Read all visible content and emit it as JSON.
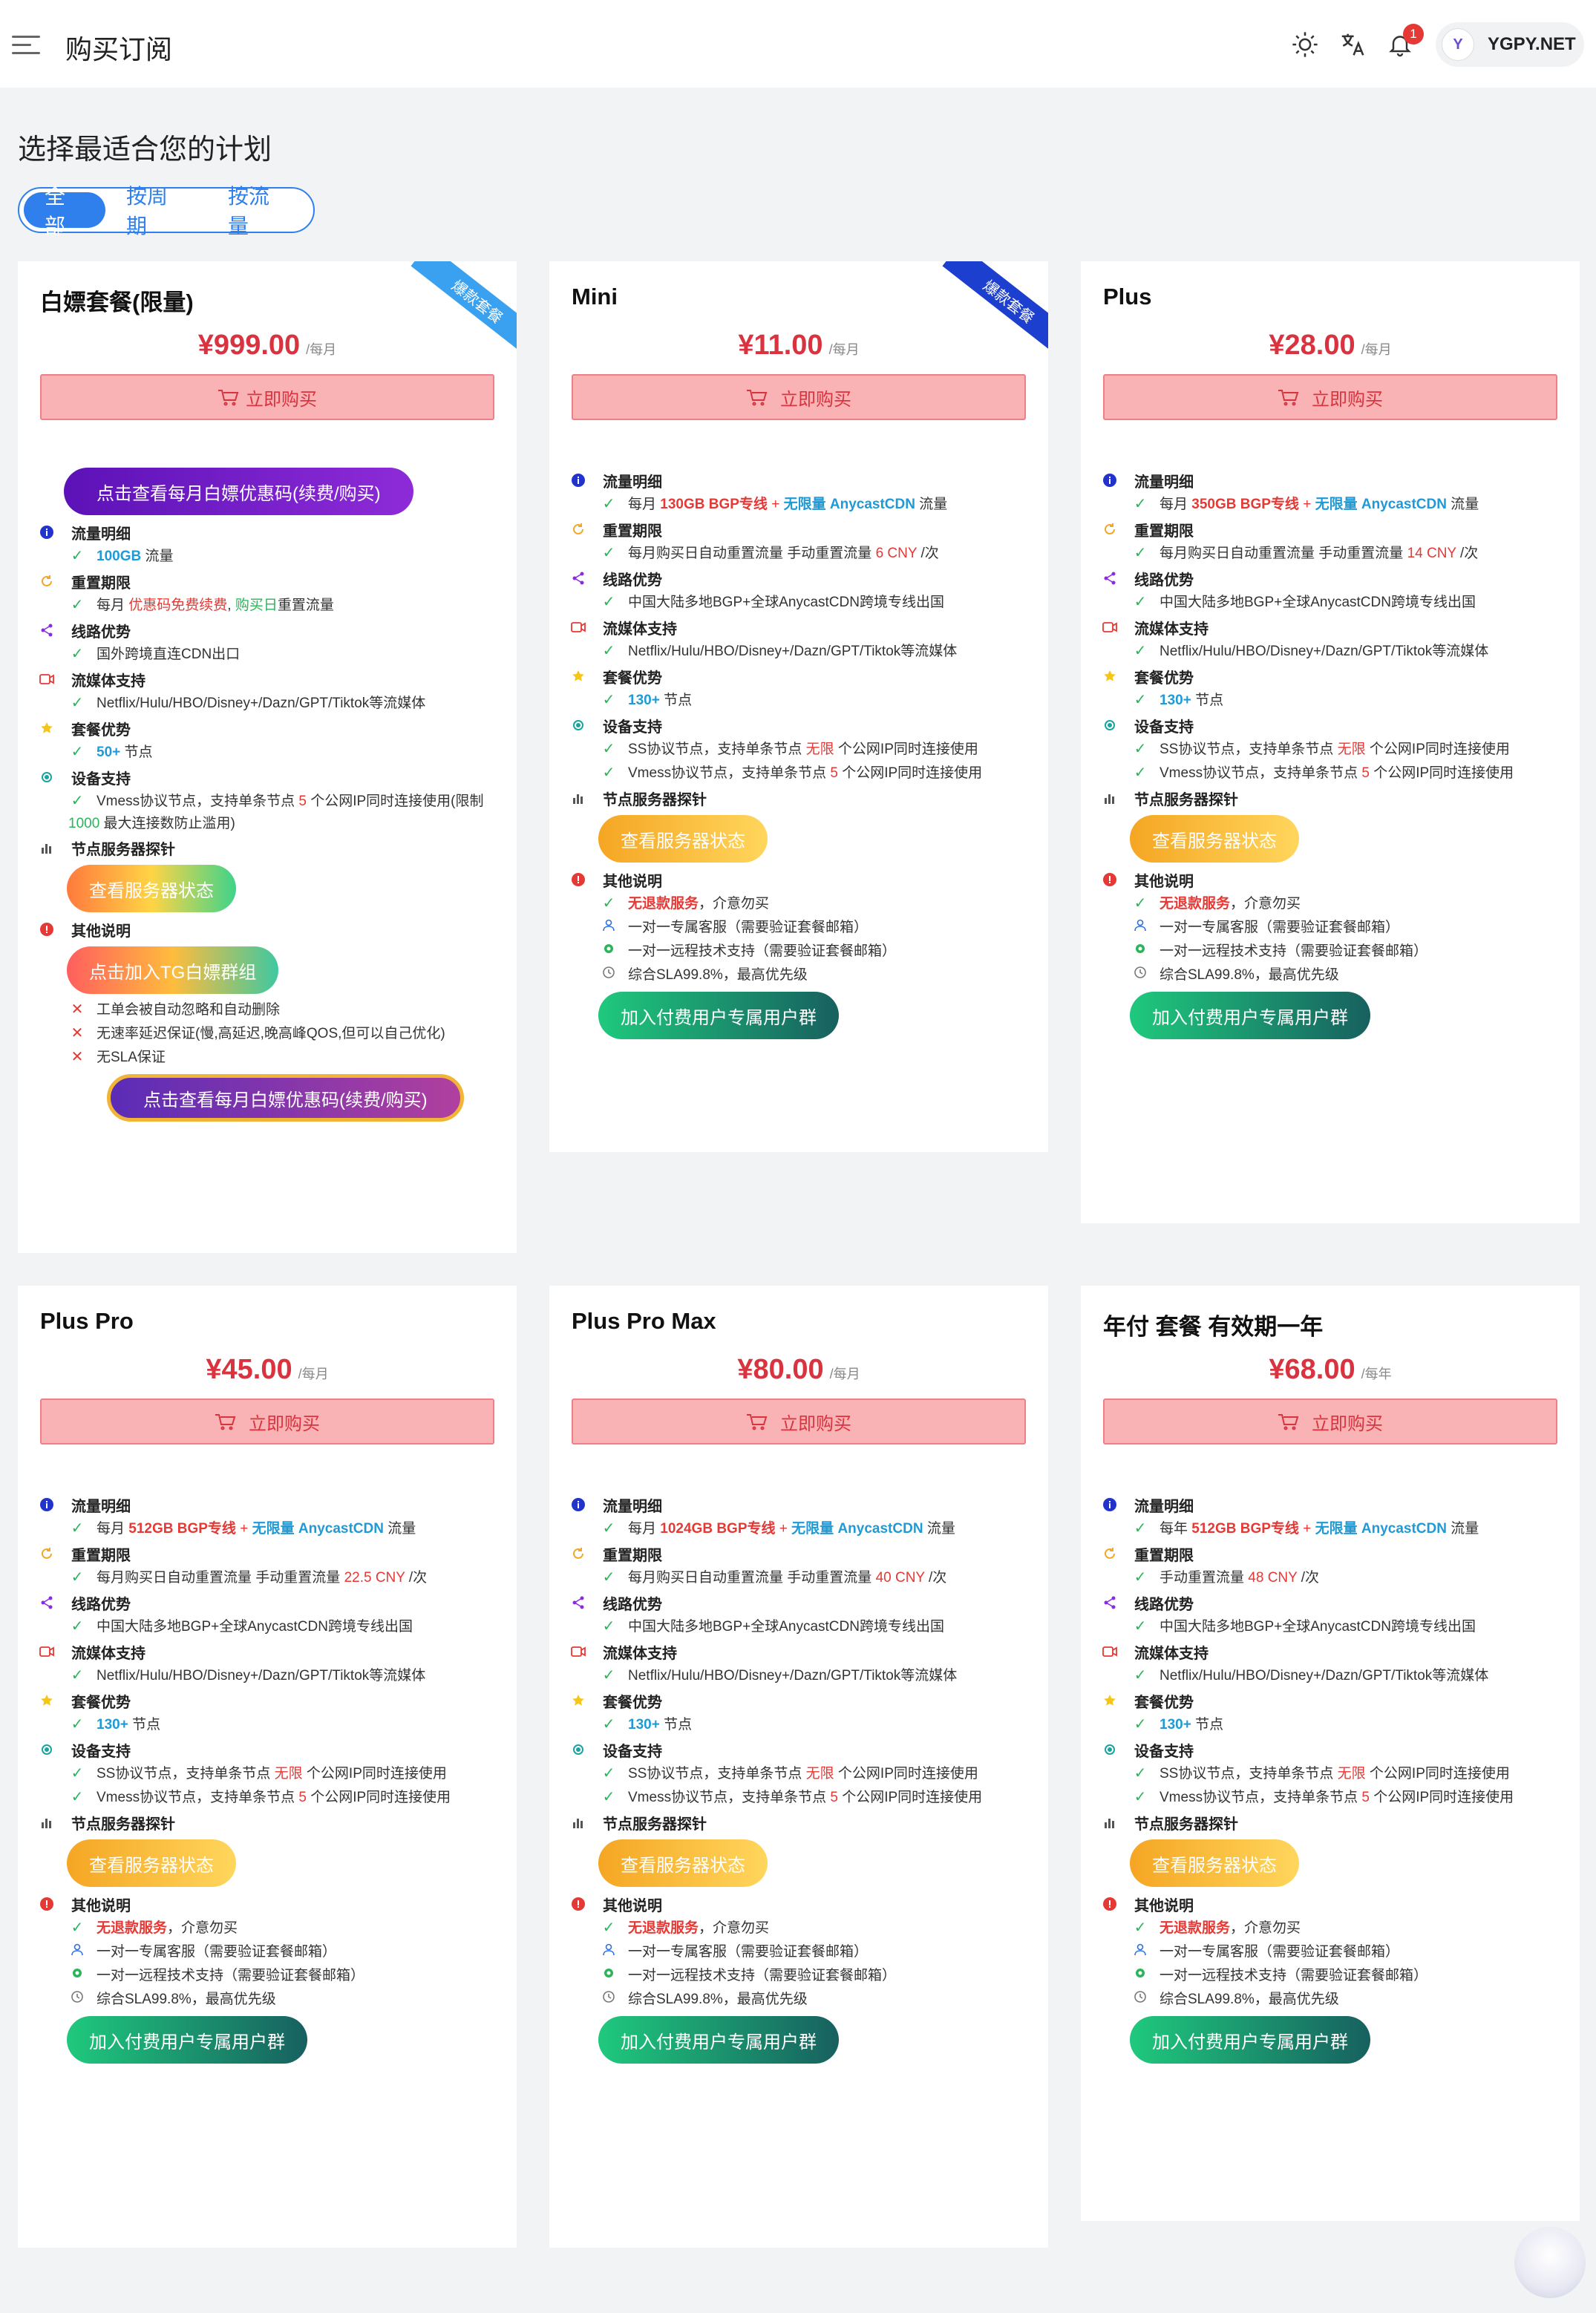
{
  "header": {
    "title": "购买订阅",
    "user": {
      "initial": "Y",
      "name": "YGPY.NET"
    },
    "notifications": 1,
    "icons": [
      "menu-icon",
      "sun-icon",
      "translate-icon",
      "bell-icon"
    ]
  },
  "main": {
    "heading": "选择最适合您的计划",
    "filters": [
      "全部",
      "按周期",
      "按流量"
    ],
    "active_filter": "全部"
  },
  "buy_label": "立即购买",
  "labels": {
    "traffic": "流量明细",
    "reset": "重置期限",
    "line": "线路优势",
    "streaming": "流媒体支持",
    "plan": "套餐优势",
    "device": "设备支持",
    "probe": "节点服务器探针",
    "other": "其他说明",
    "status_btn": "查看服务器状态",
    "group_btn": "加入付费用户专属用户群"
  },
  "cards": [
    {
      "name": "白嫖套餐(限量)",
      "price": "¥999.00",
      "unit": "/每月",
      "ribbon": "爆款套餐",
      "promo_btn": "点击查看每月白嫖优惠码(续费/购买)",
      "traffic": {
        "a": "100GB",
        "b": " 流量"
      },
      "reset": {
        "a": "每月 ",
        "b": "优惠码免费续费",
        "c": ", ",
        "d": "购买日",
        "e": "重置流量"
      },
      "line": "国外跨境直连CDN出口",
      "streaming": "Netflix/Hulu/HBO/Disney+/Dazn/GPT/Tiktok等流媒体",
      "nodes": {
        "a": "50+",
        "b": " 节点"
      },
      "device": {
        "a": "Vmess协议节点，支持单条节点 ",
        "b": "5",
        "c": " 个公网IP同时连接使用(限制",
        "d": "1000",
        "e": " 最大连接数防止滥用)"
      },
      "tg_btn": "点击加入TG白嫖群组",
      "notes": [
        "工单会被自动忽略和自动删除",
        "无速率延迟保证(慢,高延迟,晚高峰QOS,但可以自己优化)",
        "无SLA保证"
      ],
      "promo_btn2": "点击查看每月白嫖优惠码(续费/购买)"
    },
    {
      "name": "Mini",
      "price": "¥11.00",
      "unit": "/每月",
      "ribbon": "爆款套餐",
      "traffic": {
        "a": "每月 ",
        "b": "130GB BGP专线",
        "c": " + ",
        "d": "无限量 AnycastCDN",
        "e": " 流量"
      },
      "reset": {
        "a": "每月购买日自动重置流量 手动重置流量 ",
        "b": "6 CNY",
        "c": " /次"
      },
      "line": "中国大陆多地BGP+全球AnycastCDN跨境专线出国",
      "streaming": "Netflix/Hulu/HBO/Disney+/Dazn/GPT/Tiktok等流媒体",
      "nodes": {
        "a": "130+",
        "b": " 节点"
      },
      "ss": {
        "a": "SS协议节点，支持单条节点 ",
        "b": "无限",
        "c": " 个公网IP同时连接使用"
      },
      "vmess": {
        "a": "Vmess协议节点，支持单条节点 ",
        "b": "5",
        "c": " 个公网IP同时连接使用"
      },
      "other": {
        "a": "无退款服务",
        "b": "，介意勿买",
        "c": "一对一专属客服（需要验证套餐邮箱）",
        "d": "一对一远程技术支持（需要验证套餐邮箱）",
        "e": "综合SLA99.8%，最高优先级"
      }
    },
    {
      "name": "Plus",
      "price": "¥28.00",
      "unit": "/每月",
      "traffic": {
        "a": "每月 ",
        "b": "350GB BGP专线",
        "c": " + ",
        "d": "无限量 AnycastCDN",
        "e": " 流量"
      },
      "reset": {
        "a": "每月购买日自动重置流量 手动重置流量 ",
        "b": "14 CNY",
        "c": " /次"
      },
      "line": "中国大陆多地BGP+全球AnycastCDN跨境专线出国",
      "streaming": "Netflix/Hulu/HBO/Disney+/Dazn/GPT/Tiktok等流媒体",
      "nodes": {
        "a": "130+",
        "b": " 节点"
      },
      "ss": {
        "a": "SS协议节点，支持单条节点 ",
        "b": "无限",
        "c": " 个公网IP同时连接使用"
      },
      "vmess": {
        "a": "Vmess协议节点，支持单条节点 ",
        "b": "5",
        "c": " 个公网IP同时连接使用"
      },
      "other": {
        "a": "无退款服务",
        "b": "，介意勿买",
        "c": "一对一专属客服（需要验证套餐邮箱）",
        "d": "一对一远程技术支持（需要验证套餐邮箱）",
        "e": "综合SLA99.8%，最高优先级"
      }
    },
    {
      "name": "Plus Pro",
      "price": "¥45.00",
      "unit": "/每月",
      "traffic": {
        "a": "每月 ",
        "b": "512GB BGP专线",
        "c": " + ",
        "d": "无限量 AnycastCDN",
        "e": " 流量"
      },
      "reset": {
        "a": "每月购买日自动重置流量 手动重置流量 ",
        "b": "22.5 CNY",
        "c": " /次"
      },
      "line": "中国大陆多地BGP+全球AnycastCDN跨境专线出国",
      "streaming": "Netflix/Hulu/HBO/Disney+/Dazn/GPT/Tiktok等流媒体",
      "nodes": {
        "a": "130+",
        "b": " 节点"
      },
      "ss": {
        "a": "SS协议节点，支持单条节点 ",
        "b": "无限",
        "c": " 个公网IP同时连接使用"
      },
      "vmess": {
        "a": "Vmess协议节点，支持单条节点 ",
        "b": "5",
        "c": " 个公网IP同时连接使用"
      },
      "other": {
        "a": "无退款服务",
        "b": "，介意勿买",
        "c": "一对一专属客服（需要验证套餐邮箱）",
        "d": "一对一远程技术支持（需要验证套餐邮箱）",
        "e": "综合SLA99.8%，最高优先级"
      }
    },
    {
      "name": "Plus Pro Max",
      "price": "¥80.00",
      "unit": "/每月",
      "traffic": {
        "a": "每月 ",
        "b": "1024GB BGP专线",
        "c": " + ",
        "d": "无限量 AnycastCDN",
        "e": " 流量"
      },
      "reset": {
        "a": "每月购买日自动重置流量 手动重置流量 ",
        "b": "40 CNY",
        "c": " /次"
      },
      "line": "中国大陆多地BGP+全球AnycastCDN跨境专线出国",
      "streaming": "Netflix/Hulu/HBO/Disney+/Dazn/GPT/Tiktok等流媒体",
      "nodes": {
        "a": "130+",
        "b": " 节点"
      },
      "ss": {
        "a": "SS协议节点，支持单条节点 ",
        "b": "无限",
        "c": " 个公网IP同时连接使用"
      },
      "vmess": {
        "a": "Vmess协议节点，支持单条节点 ",
        "b": "5",
        "c": " 个公网IP同时连接使用"
      },
      "other": {
        "a": "无退款服务",
        "b": "，介意勿买",
        "c": "一对一专属客服（需要验证套餐邮箱）",
        "d": "一对一远程技术支持（需要验证套餐邮箱）",
        "e": "综合SLA99.8%，最高优先级"
      }
    },
    {
      "name": "年付 套餐 有效期一年",
      "price": "¥68.00",
      "unit": "/每年",
      "traffic": {
        "a": "每年 ",
        "b": "512GB BGP专线",
        "c": " + ",
        "d": "无限量 AnycastCDN",
        "e": " 流量"
      },
      "reset": {
        "a": "手动重置流量 ",
        "b": "48 CNY",
        "c": " /次"
      },
      "line": "中国大陆多地BGP+全球AnycastCDN跨境专线出国",
      "streaming": "Netflix/Hulu/HBO/Disney+/Dazn/GPT/Tiktok等流媒体",
      "nodes": {
        "a": "130+",
        "b": " 节点"
      },
      "ss": {
        "a": "SS协议节点，支持单条节点 ",
        "b": "无限",
        "c": " 个公网IP同时连接使用"
      },
      "vmess": {
        "a": "Vmess协议节点，支持单条节点 ",
        "b": "5",
        "c": " 个公网IP同时连接使用"
      },
      "other": {
        "a": "无退款服务",
        "b": "，介意勿买",
        "c": "一对一专属客服（需要验证套餐邮箱）",
        "d": "一对一远程技术支持（需要验证套餐邮箱）",
        "e": "综合SLA99.8%，最高优先级"
      }
    }
  ]
}
